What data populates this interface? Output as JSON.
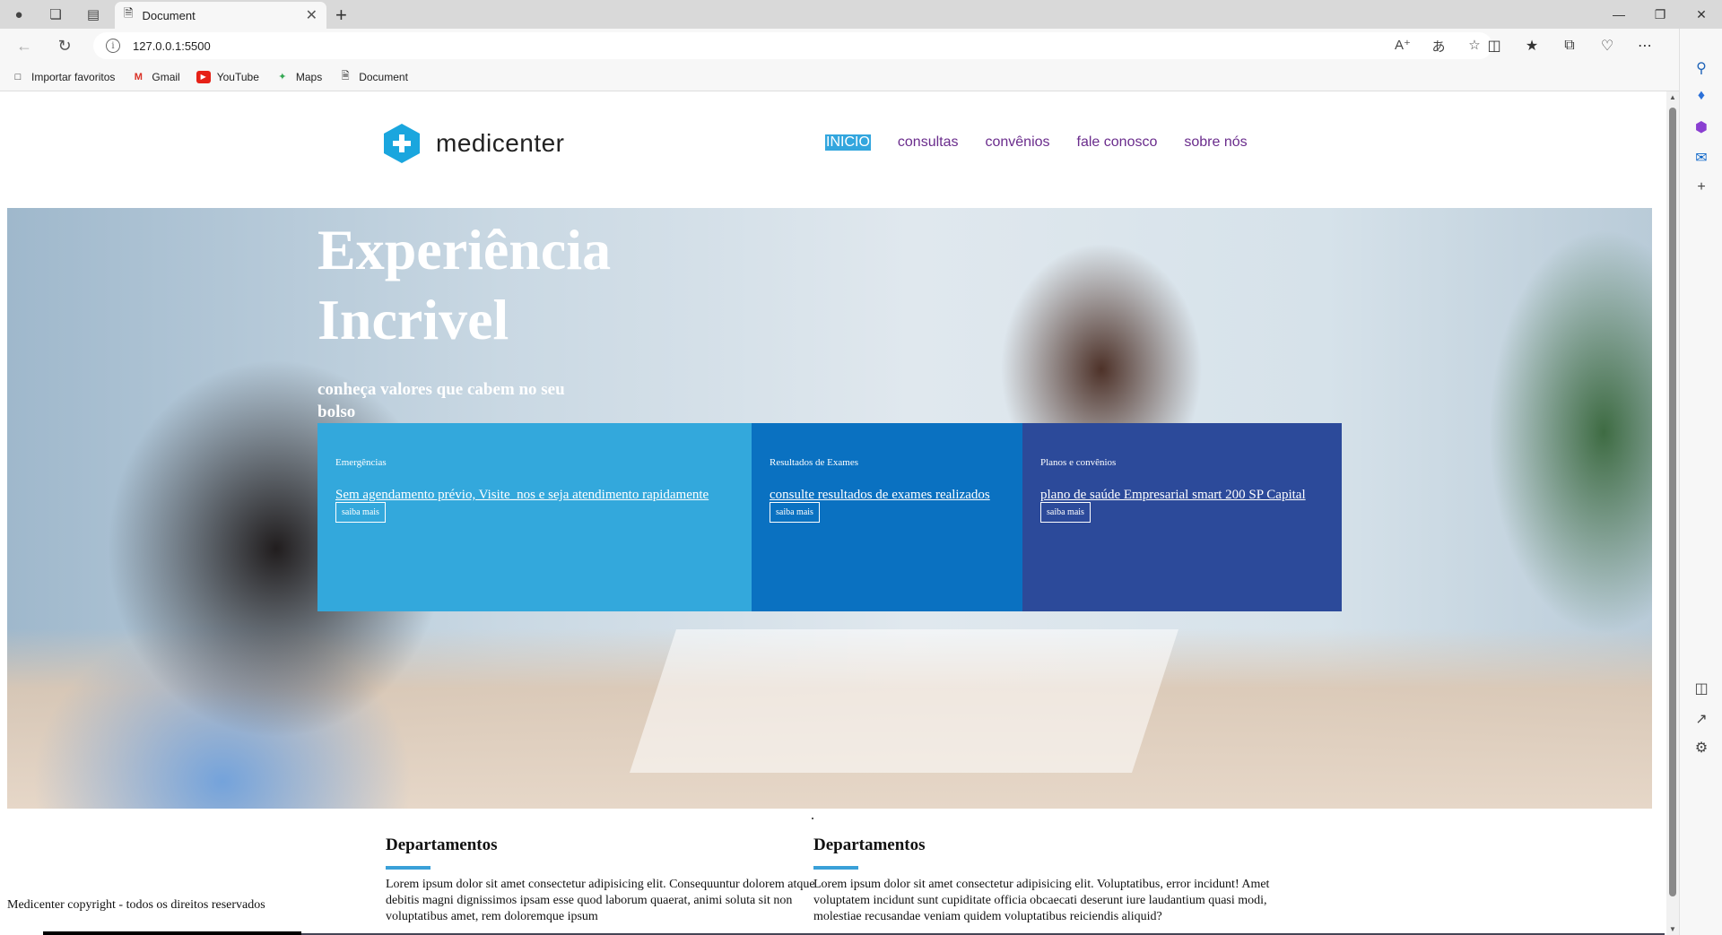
{
  "browser": {
    "tab_title": "Document",
    "url": "127.0.0.1:5500",
    "favorites": [
      {
        "label": "Importar favoritos",
        "icon": "import-icon"
      },
      {
        "label": "Gmail",
        "icon": "gmail-icon"
      },
      {
        "label": "YouTube",
        "icon": "youtube-icon"
      },
      {
        "label": "Maps",
        "icon": "maps-icon"
      },
      {
        "label": "Document",
        "icon": "document-icon"
      }
    ]
  },
  "site": {
    "logo_text": "medicenter",
    "nav": [
      "INICIO",
      "consultas",
      "convênios",
      "fale conosco",
      "sobre nós"
    ],
    "hero": {
      "title": "Experiência Incrivel",
      "subtitle": "conheça valores que cabem no seu bolso"
    },
    "cards": [
      {
        "label": "Emergências",
        "text": "Sem agendamento prévio, Visite_nos e seja atendimento rapidamente",
        "button": "saiba mais"
      },
      {
        "label": "Resultados de Exames",
        "text": "consulte resultados de exames realizados",
        "button": "saiba mais"
      },
      {
        "label": "Planos e convênios",
        "text": "plano de saúde Empresarial smart 200 SP Capital",
        "button": "saiba mais"
      }
    ],
    "departments": [
      {
        "title": "Departamentos",
        "text": "Lorem ipsum dolor sit amet consectetur adipisicing elit. Consequuntur dolorem atque debitis magni dignissimos ipsam esse quod laborum quaerat, animi soluta sit non voluptatibus amet, rem doloremque ipsum"
      },
      {
        "title": "Departamentos",
        "text": "Lorem ipsum dolor sit amet consectetur adipisicing elit. Voluptatibus, error incidunt! Amet voluptatem incidunt sunt cupiditate officia obcaecati deserunt iure laudantium quasi modi, molestiae recusandae veniam quidem voluptatibus reiciendis aliquid?"
      }
    ],
    "copyright": "Medicenter copyright - todos os direitos reservados"
  },
  "colors": {
    "card1": "#33a8dc",
    "card2": "#0a71c1",
    "card3": "#2c4a9a",
    "accent": "#33a6de",
    "nav_link": "#6a2c8c"
  }
}
